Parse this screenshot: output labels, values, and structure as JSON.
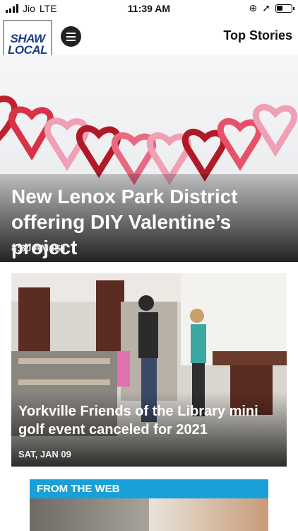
{
  "status_bar": {
    "carrier": "Jio",
    "network": "LTE",
    "time": "11:39 AM"
  },
  "header": {
    "logo_line1": "SHAW",
    "logo_line2": "LOCAL",
    "section_title": "Top Stories"
  },
  "stories": [
    {
      "title": "New Lenox Park District offering DIY Valentine’s project",
      "time": "8:30 AM IST"
    },
    {
      "title": "Yorkville Friends of the Library mini golf event canceled for 2021",
      "date": "SAT, JAN 09"
    }
  ],
  "from_the_web": {
    "label": "FROM THE WEB"
  },
  "colors": {
    "logo_blue": "#1d3a8a",
    "web_banner": "#1aa0d8",
    "heart_red": "#c0202a",
    "heart_pink": "#f0a0b4"
  }
}
